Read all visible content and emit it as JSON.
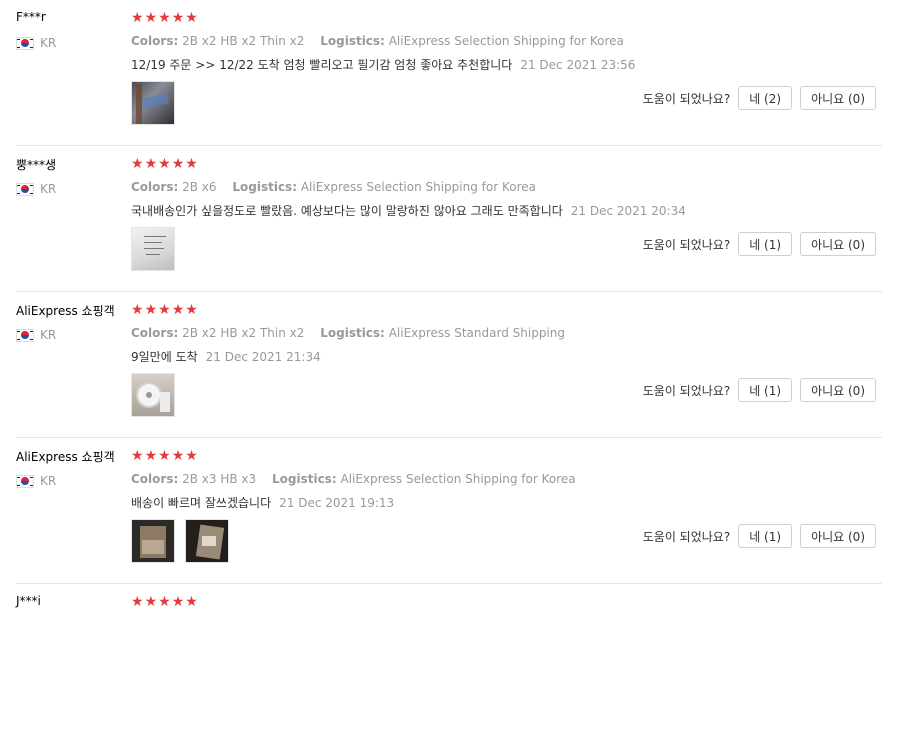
{
  "reviews": [
    {
      "user": "F***r",
      "country": "KR",
      "colors_label": "Colors:",
      "colors_value": "2B x2 HB x2 Thin x2",
      "logistics_label": "Logistics:",
      "logistics_value": "AliExpress Selection Shipping for Korea",
      "text": "12/19 주문 >> 12/22 도착 엄청 빨리오고 필기감 엄청 좋아요 추천합니다",
      "date": "21 Dec 2021 23:56",
      "helpful_label": "도움이 되었나요?",
      "yes_label": "네 (2)",
      "no_label": "아니요 (0)"
    },
    {
      "user": "뿡***생",
      "country": "KR",
      "colors_label": "Colors:",
      "colors_value": "2B x6",
      "logistics_label": "Logistics:",
      "logistics_value": "AliExpress Selection Shipping for Korea",
      "text": "국내배송인가 싶을정도로 빨랐음. 예상보다는 많이 말랑하진 않아요 그래도 만족합니다",
      "date": "21 Dec 2021 20:34",
      "helpful_label": "도움이 되었나요?",
      "yes_label": "네 (1)",
      "no_label": "아니요 (0)"
    },
    {
      "user": "AliExpress 쇼핑객",
      "country": "KR",
      "colors_label": "Colors:",
      "colors_value": "2B x2 HB x2 Thin x2",
      "logistics_label": "Logistics:",
      "logistics_value": "AliExpress Standard Shipping",
      "text": "9일만에 도착",
      "date": "21 Dec 2021 21:34",
      "helpful_label": "도움이 되었나요?",
      "yes_label": "네 (1)",
      "no_label": "아니요 (0)"
    },
    {
      "user": "AliExpress 쇼핑객",
      "country": "KR",
      "colors_label": "Colors:",
      "colors_value": "2B x3 HB x3",
      "logistics_label": "Logistics:",
      "logistics_value": "AliExpress Selection Shipping for Korea",
      "text": "배송이 빠르며 잘쓰겠습니다",
      "date": "21 Dec 2021 19:13",
      "helpful_label": "도움이 되었나요?",
      "yes_label": "네 (1)",
      "no_label": "아니요 (0)"
    },
    {
      "user": "J***i"
    }
  ],
  "colors": {
    "star": "#e6393d",
    "meta": "#999999",
    "separator": "#e6e6e6"
  },
  "icons": {
    "star": "star-icon",
    "flag": "korea-flag-icon"
  }
}
